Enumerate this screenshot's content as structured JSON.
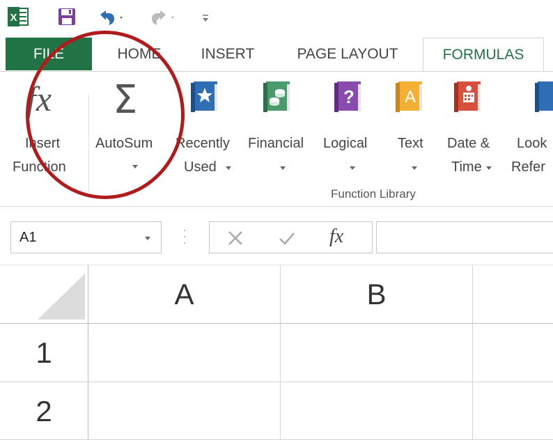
{
  "qat": {
    "icons": [
      "excel-logo-icon",
      "save-icon",
      "undo-icon",
      "redo-icon",
      "customize-qat-icon"
    ]
  },
  "tabs": {
    "file": "FILE",
    "home": "HOME",
    "insert": "INSERT",
    "page_layout": "PAGE LAYOUT",
    "formulas": "FORMULAS"
  },
  "ribbon": {
    "insert_function": {
      "line1": "Insert",
      "line2": "Function",
      "icon_text": "fx"
    },
    "autosum": {
      "label": "AutoSum",
      "icon_text": "Σ"
    },
    "recently_used": {
      "line1": "Recently",
      "line2": "Used"
    },
    "financial": {
      "label": "Financial"
    },
    "logical": {
      "label": "Logical",
      "icon_text": "?"
    },
    "text": {
      "label": "Text",
      "icon_text": "A"
    },
    "date_time": {
      "line1": "Date &",
      "line2": "Time"
    },
    "lookup": {
      "line1": "Look",
      "line2": "Refer"
    },
    "group_label": "Function Library",
    "colors": {
      "recently_used": "#2f6eb5",
      "financial": "#4a9a6b",
      "logical": "#8a4baf",
      "text": "#f2b134",
      "date_time": "#d8503c",
      "lookup": "#2f6eb5"
    }
  },
  "formula_bar": {
    "name_box_value": "A1",
    "fx_label": "fx"
  },
  "grid": {
    "columns": [
      "A",
      "B"
    ],
    "rows": [
      "1",
      "2"
    ]
  },
  "accent": "#217346",
  "annotation_color": "#b01c1c"
}
